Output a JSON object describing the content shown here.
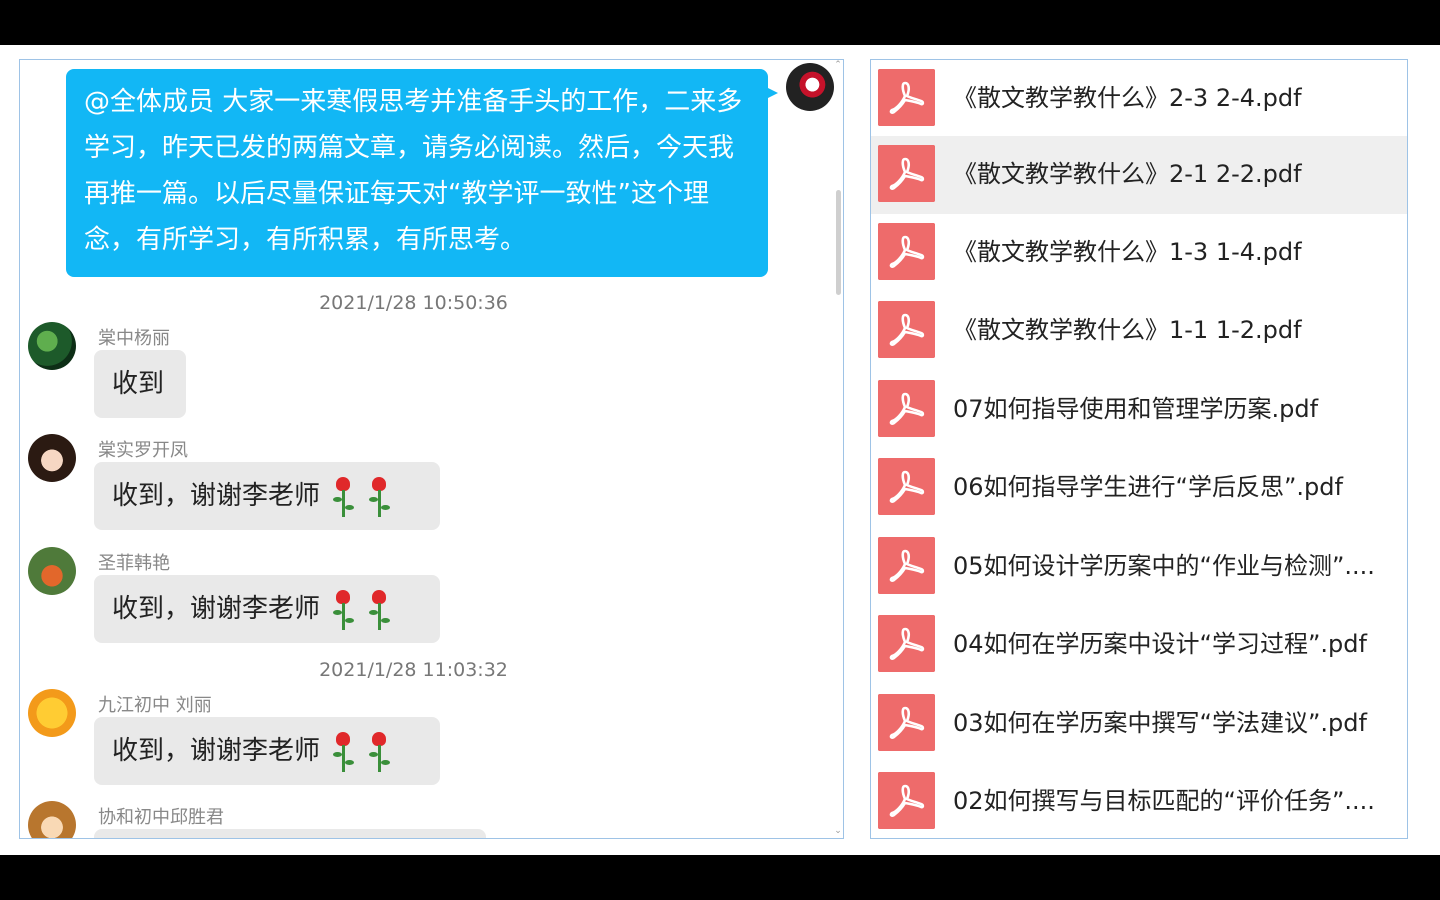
{
  "chat": {
    "sent_message": "@全体成员 大家一来寒假思考并准备手头的工作，二来多学习，昨天已发的两篇文章，请务必阅读。然后，今天我再推一篇。以后尽量保证每天对“教学评一致性”这个理念，有所学习，有所积累，有所思考。",
    "timestamps": [
      "2021/1/28 10:50:36",
      "2021/1/28 11:03:32"
    ],
    "messages": [
      {
        "user": "棠中杨丽",
        "text": "收到",
        "roses": 0
      },
      {
        "user": "棠实罗开凤",
        "text": "收到，谢谢李老师",
        "roses": 2
      },
      {
        "user": "圣菲韩艳",
        "text": "收到，谢谢李老师",
        "roses": 2
      },
      {
        "user": "九江初中 刘丽",
        "text": "收到，谢谢李老师",
        "roses": 2
      },
      {
        "user": "协和初中邱胜君",
        "text": "",
        "roses": 0
      }
    ]
  },
  "files": [
    {
      "name": "《散文教学教什么》2-3 2-4.pdf",
      "selected": false
    },
    {
      "name": "《散文教学教什么》2-1 2-2.pdf",
      "selected": true
    },
    {
      "name": "《散文教学教什么》1-3 1-4.pdf",
      "selected": false
    },
    {
      "name": "《散文教学教什么》1-1 1-2.pdf",
      "selected": false
    },
    {
      "name": "07如何指导使用和管理学历案.pdf",
      "selected": false
    },
    {
      "name": "06如何指导学生进行“学后反思”.pdf",
      "selected": false
    },
    {
      "name": "05如何设计学历案中的“作业与检测”....",
      "selected": false
    },
    {
      "name": "04如何在学历案中设计“学习过程”.pdf",
      "selected": false
    },
    {
      "name": "03如何在学历案中撰写“学法建议”.pdf",
      "selected": false
    },
    {
      "name": "02如何撰写与目标匹配的“评价任务”....",
      "selected": false
    }
  ],
  "colors": {
    "sent_bubble": "#12b7f5",
    "received_bubble": "#e9e9e9",
    "pdf_icon": "#ee6b6b",
    "panel_border": "#9ec3e6"
  }
}
